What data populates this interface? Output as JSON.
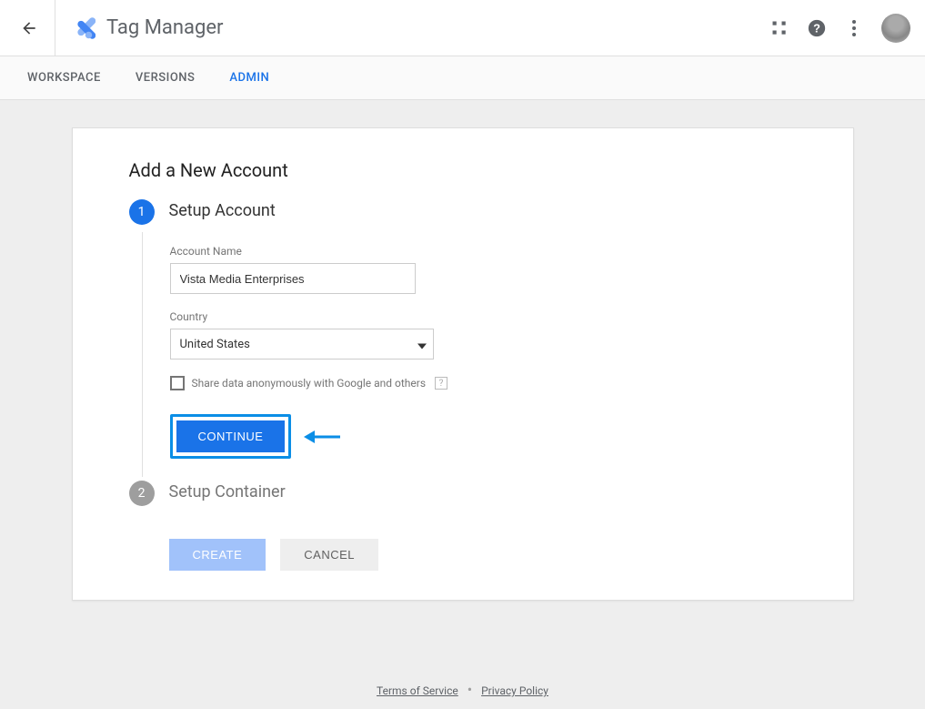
{
  "header": {
    "app_title": "Tag Manager"
  },
  "tabs": {
    "workspace": "WORKSPACE",
    "versions": "VERSIONS",
    "admin": "ADMIN"
  },
  "card": {
    "title": "Add a New Account",
    "step1": {
      "num": "1",
      "title": "Setup Account",
      "account_name_label": "Account Name",
      "account_name_value": "Vista Media Enterprises",
      "country_label": "Country",
      "country_value": "United States",
      "share_label": "Share data anonymously with Google and others",
      "help_q": "?",
      "continue_label": "CONTINUE"
    },
    "step2": {
      "num": "2",
      "title": "Setup Container"
    },
    "actions": {
      "create": "CREATE",
      "cancel": "CANCEL"
    }
  },
  "footer": {
    "tos": "Terms of Service",
    "privacy": "Privacy Policy"
  }
}
